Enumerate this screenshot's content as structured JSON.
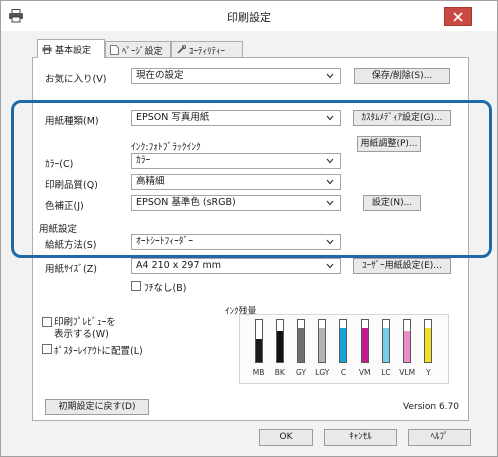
{
  "window": {
    "title": "印刷設定"
  },
  "tabs": [
    {
      "label": "基本設定",
      "icon": "printer-icon",
      "active": true
    },
    {
      "label": "ﾍﾟｰｼﾞ設定",
      "icon": "page-icon",
      "active": false
    },
    {
      "label": "ﾕｰﾃｨﾘﾃｨｰ",
      "icon": "wrench-icon",
      "active": false
    }
  ],
  "favorites": {
    "label": "お気に入り(V)",
    "value": "現在の設定",
    "button": "保存/削除(S)..."
  },
  "media_type": {
    "label": "用紙種類(M)",
    "value": "EPSON 写真用紙",
    "button": "ｶｽﾀﾑﾒﾃﾞｨｱ設定(G)..."
  },
  "ink": {
    "text": "ｲﾝｸ:ﾌｫﾄﾌﾞﾗｯｸｲﾝｸ",
    "button": "用紙調整(P)..."
  },
  "color": {
    "label": "ｶﾗｰ(C)",
    "value": "ｶﾗｰ"
  },
  "quality": {
    "label": "印刷品質(Q)",
    "value": "高精細"
  },
  "color_correction": {
    "label": "色補正(J)",
    "value": "EPSON 基準色 (sRGB)",
    "button": "設定(N)..."
  },
  "paper_settings": {
    "group_label": "用紙設定",
    "source": {
      "label": "給紙方法(S)",
      "value": "ｵｰﾄｼｰﾄﾌｨｰﾀﾞｰ"
    },
    "size": {
      "label": "用紙ｻｲｽﾞ(Z)",
      "value": "A4 210 x 297 mm",
      "button": "ﾕｰｻﾞｰ用紙設定(E)..."
    },
    "borderless": {
      "label": "ﾌﾁなし(B)",
      "checked": false
    }
  },
  "preview": {
    "label_line1": "印刷ﾌﾟﾚﾋﾞｭｰを",
    "label_line2": "表示する(W)",
    "checked": false
  },
  "layout": {
    "label": "ﾎﾟｽﾀｰﾚｲｱｳﾄに配置(L)",
    "checked": false
  },
  "ink_levels": {
    "label": "ｲﾝｸ残量",
    "inks": [
      {
        "name": "MB",
        "color": "#1a1a1a",
        "level": 0.55
      },
      {
        "name": "BK",
        "color": "#111111",
        "level": 0.75
      },
      {
        "name": "GY",
        "color": "#6f6f6f",
        "level": 0.8
      },
      {
        "name": "LGY",
        "color": "#b3b3b3",
        "level": 0.8
      },
      {
        "name": "C",
        "color": "#1aa3d6",
        "level": 0.8
      },
      {
        "name": "VM",
        "color": "#c21d8f",
        "level": 0.8
      },
      {
        "name": "LC",
        "color": "#74cdeb",
        "level": 0.8
      },
      {
        "name": "VLM",
        "color": "#ee8ac6",
        "level": 0.75
      },
      {
        "name": "Y",
        "color": "#efe025",
        "level": 0.8
      }
    ]
  },
  "reset_button": "初期設定に戻す(D)",
  "version": "Version 6.70",
  "footer": {
    "ok": "OK",
    "cancel": "ｷｬﾝｾﾙ",
    "help": "ﾍﾙﾌﾟ"
  },
  "colors": {
    "highlight": "#1f6aa6",
    "close_button": "#c94a42"
  }
}
